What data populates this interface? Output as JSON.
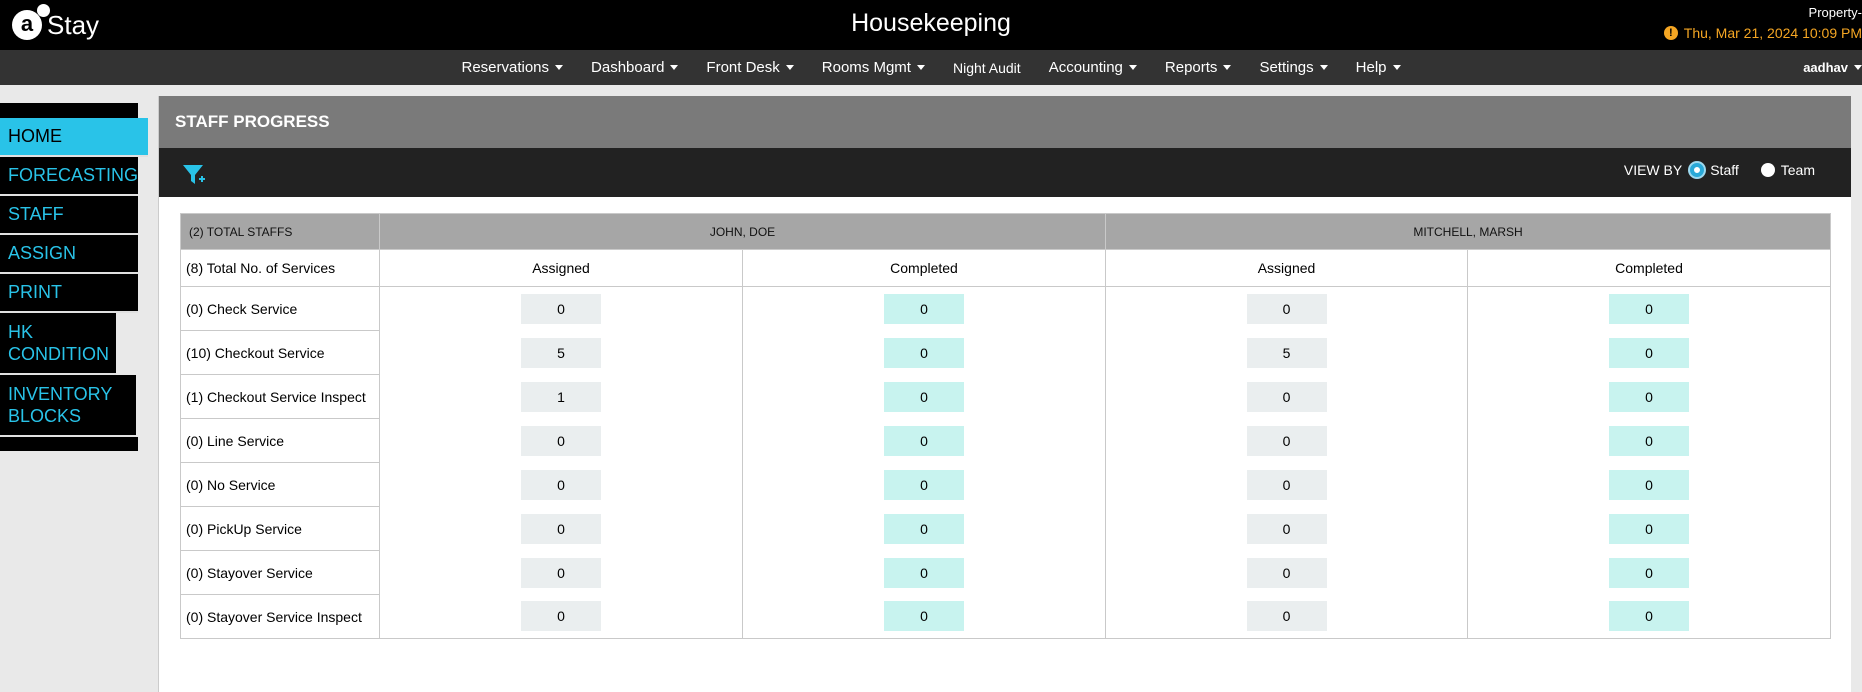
{
  "header": {
    "logo_letter": "a",
    "logo_text": "Stay",
    "title": "Housekeeping",
    "property": "Property-",
    "datetime": "Thu, Mar 21, 2024 10:09 PM"
  },
  "menu": {
    "items": [
      {
        "label": "Reservations"
      },
      {
        "label": "Dashboard"
      },
      {
        "label": "Front Desk"
      },
      {
        "label": "Rooms Mgmt"
      },
      {
        "label": "Night Audit"
      },
      {
        "label": "Accounting"
      },
      {
        "label": "Reports"
      },
      {
        "label": "Settings"
      },
      {
        "label": "Help"
      }
    ],
    "user": "aadhav"
  },
  "sidebar": {
    "items": [
      {
        "label": "HOME"
      },
      {
        "label": "FORECASTING"
      },
      {
        "label": "STAFF"
      },
      {
        "label": "ASSIGN"
      },
      {
        "label": "PRINT"
      },
      {
        "label": "HK CONDITION"
      },
      {
        "label": "INVENTORY BLOCKS"
      }
    ]
  },
  "panel": {
    "title": "STAFF PROGRESS",
    "viewby_label": "VIEW BY",
    "options": [
      "Staff",
      "Team"
    ],
    "selected_option": "Staff"
  },
  "table": {
    "total_staffs": "(2) TOTAL STAFFS",
    "total_services": "(8) Total No. of Services",
    "staff": [
      "JOHN, DOE",
      "MITCHELL, MARSH"
    ],
    "assigned_label": "Assigned",
    "completed_label": "Completed",
    "rows": [
      {
        "service": "(0) Check Service",
        "values": [
          "0",
          "0",
          "0",
          "0"
        ]
      },
      {
        "service": "(10) Checkout Service",
        "values": [
          "5",
          "0",
          "5",
          "0"
        ]
      },
      {
        "service": "(1) Checkout Service Inspect",
        "values": [
          "1",
          "0",
          "0",
          "0"
        ]
      },
      {
        "service": "(0) Line Service",
        "values": [
          "0",
          "0",
          "0",
          "0"
        ]
      },
      {
        "service": "(0) No Service",
        "values": [
          "0",
          "0",
          "0",
          "0"
        ]
      },
      {
        "service": "(0) PickUp Service",
        "values": [
          "0",
          "0",
          "0",
          "0"
        ]
      },
      {
        "service": "(0) Stayover Service",
        "values": [
          "0",
          "0",
          "0",
          "0"
        ]
      },
      {
        "service": "(0) Stayover Service Inspect",
        "values": [
          "0",
          "0",
          "0",
          "0"
        ]
      }
    ]
  },
  "colors": {
    "accent": "#29c3e8",
    "completed_bg": "#c8f3ef",
    "assigned_bg": "#eaeeef",
    "warning": "#f5a623"
  }
}
